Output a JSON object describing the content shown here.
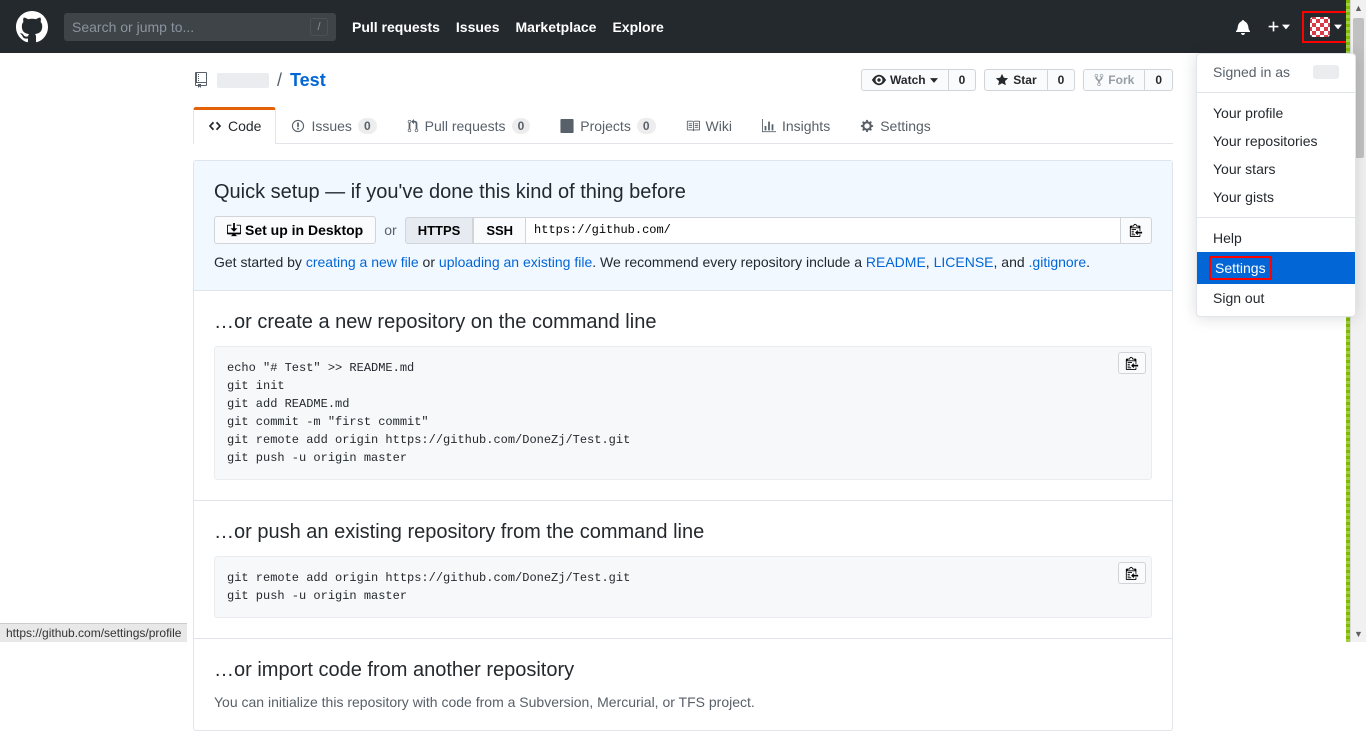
{
  "header": {
    "search_placeholder": "Search or jump to...",
    "nav": {
      "pull_requests": "Pull requests",
      "issues": "Issues",
      "marketplace": "Marketplace",
      "explore": "Explore"
    }
  },
  "dropdown": {
    "signed_in_as": "Signed in as",
    "your_profile": "Your profile",
    "your_repositories": "Your repositories",
    "your_stars": "Your stars",
    "your_gists": "Your gists",
    "help": "Help",
    "settings": "Settings",
    "sign_out": "Sign out"
  },
  "repo": {
    "owner": "",
    "sep": "/",
    "name": "Test",
    "watch_label": "Watch",
    "watch_count": "0",
    "star_label": "Star",
    "star_count": "0",
    "fork_label": "Fork",
    "fork_count": "0"
  },
  "tabs": {
    "code": "Code",
    "issues": "Issues",
    "issues_count": "0",
    "pulls": "Pull requests",
    "pulls_count": "0",
    "projects": "Projects",
    "projects_count": "0",
    "wiki": "Wiki",
    "insights": "Insights",
    "settings": "Settings"
  },
  "quick_setup": {
    "title": "Quick setup — if you've done this kind of thing before",
    "desktop_btn": "Set up in Desktop",
    "or": "or",
    "https": "HTTPS",
    "ssh": "SSH",
    "url": "https://github.com/",
    "desc_prefix": "Get started by ",
    "link_new_file": "creating a new file",
    "desc_or": " or ",
    "link_upload": "uploading an existing file",
    "desc_rec": ". We recommend every repository include a ",
    "link_readme": "README",
    "comma": ", ",
    "link_license": "LICENSE",
    "desc_and": ", and ",
    "link_gitignore": ".gitignore",
    "period": "."
  },
  "section_create": {
    "title": "…or create a new repository on the command line",
    "code": "echo \"# Test\" >> README.md\ngit init\ngit add README.md\ngit commit -m \"first commit\"\ngit remote add origin https://github.com/DoneZj/Test.git\ngit push -u origin master"
  },
  "section_push": {
    "title": "…or push an existing repository from the command line",
    "code": "git remote add origin https://github.com/DoneZj/Test.git\ngit push -u origin master"
  },
  "section_import": {
    "title": "…or import code from another repository",
    "desc": "You can initialize this repository with code from a Subversion, Mercurial, or TFS project."
  },
  "statusbar": {
    "url": "https://github.com/settings/profile"
  }
}
